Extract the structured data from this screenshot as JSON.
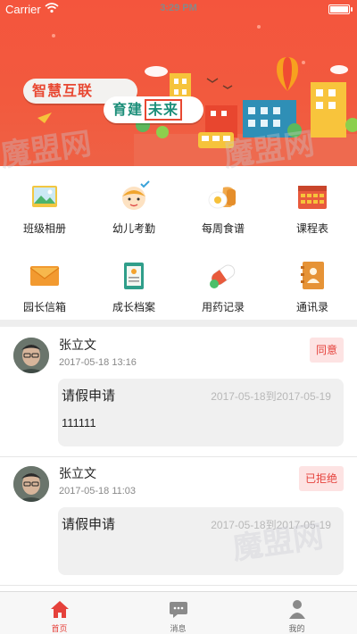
{
  "status_bar": {
    "carrier": "Carrier",
    "time": "3:29 PM"
  },
  "banner": {
    "slogan_line1": "智慧互联",
    "slogan_line2": "育建",
    "slogan_highlight": "未来"
  },
  "menu": [
    {
      "label": "班级相册",
      "icon": "photo-album-icon"
    },
    {
      "label": "幼儿考勤",
      "icon": "attendance-child-icon"
    },
    {
      "label": "每周食谱",
      "icon": "recipe-food-icon"
    },
    {
      "label": "课程表",
      "icon": "timetable-icon"
    },
    {
      "label": "园长信箱",
      "icon": "mail-envelope-icon"
    },
    {
      "label": "成长档案",
      "icon": "growth-file-icon"
    },
    {
      "label": "用药记录",
      "icon": "medicine-capsule-icon"
    },
    {
      "label": "通讯录",
      "icon": "contacts-book-icon"
    }
  ],
  "leave_requests": [
    {
      "author": "张立文",
      "time": "2017-05-18 13:16",
      "status": "同意",
      "title": "请假申请",
      "range": "2017-05-18到2017-05-19",
      "body": "111111"
    },
    {
      "author": "张立文",
      "time": "2017-05-18 11:03",
      "status": "已拒绝",
      "title": "请假申请",
      "range": "2017-05-18到2017-05-19",
      "body": ""
    }
  ],
  "tabs": [
    {
      "label": "首页",
      "icon": "home-icon",
      "active": true
    },
    {
      "label": "消息",
      "icon": "message-icon",
      "active": false
    },
    {
      "label": "我的",
      "icon": "profile-icon",
      "active": false
    }
  ],
  "watermark": {
    "text": "魔盟网"
  },
  "colors": {
    "primary": "#f4553d",
    "accent_red": "#e5413b",
    "badge_bg": "#fde3e3",
    "bubble_bg": "#f0f0f0"
  }
}
